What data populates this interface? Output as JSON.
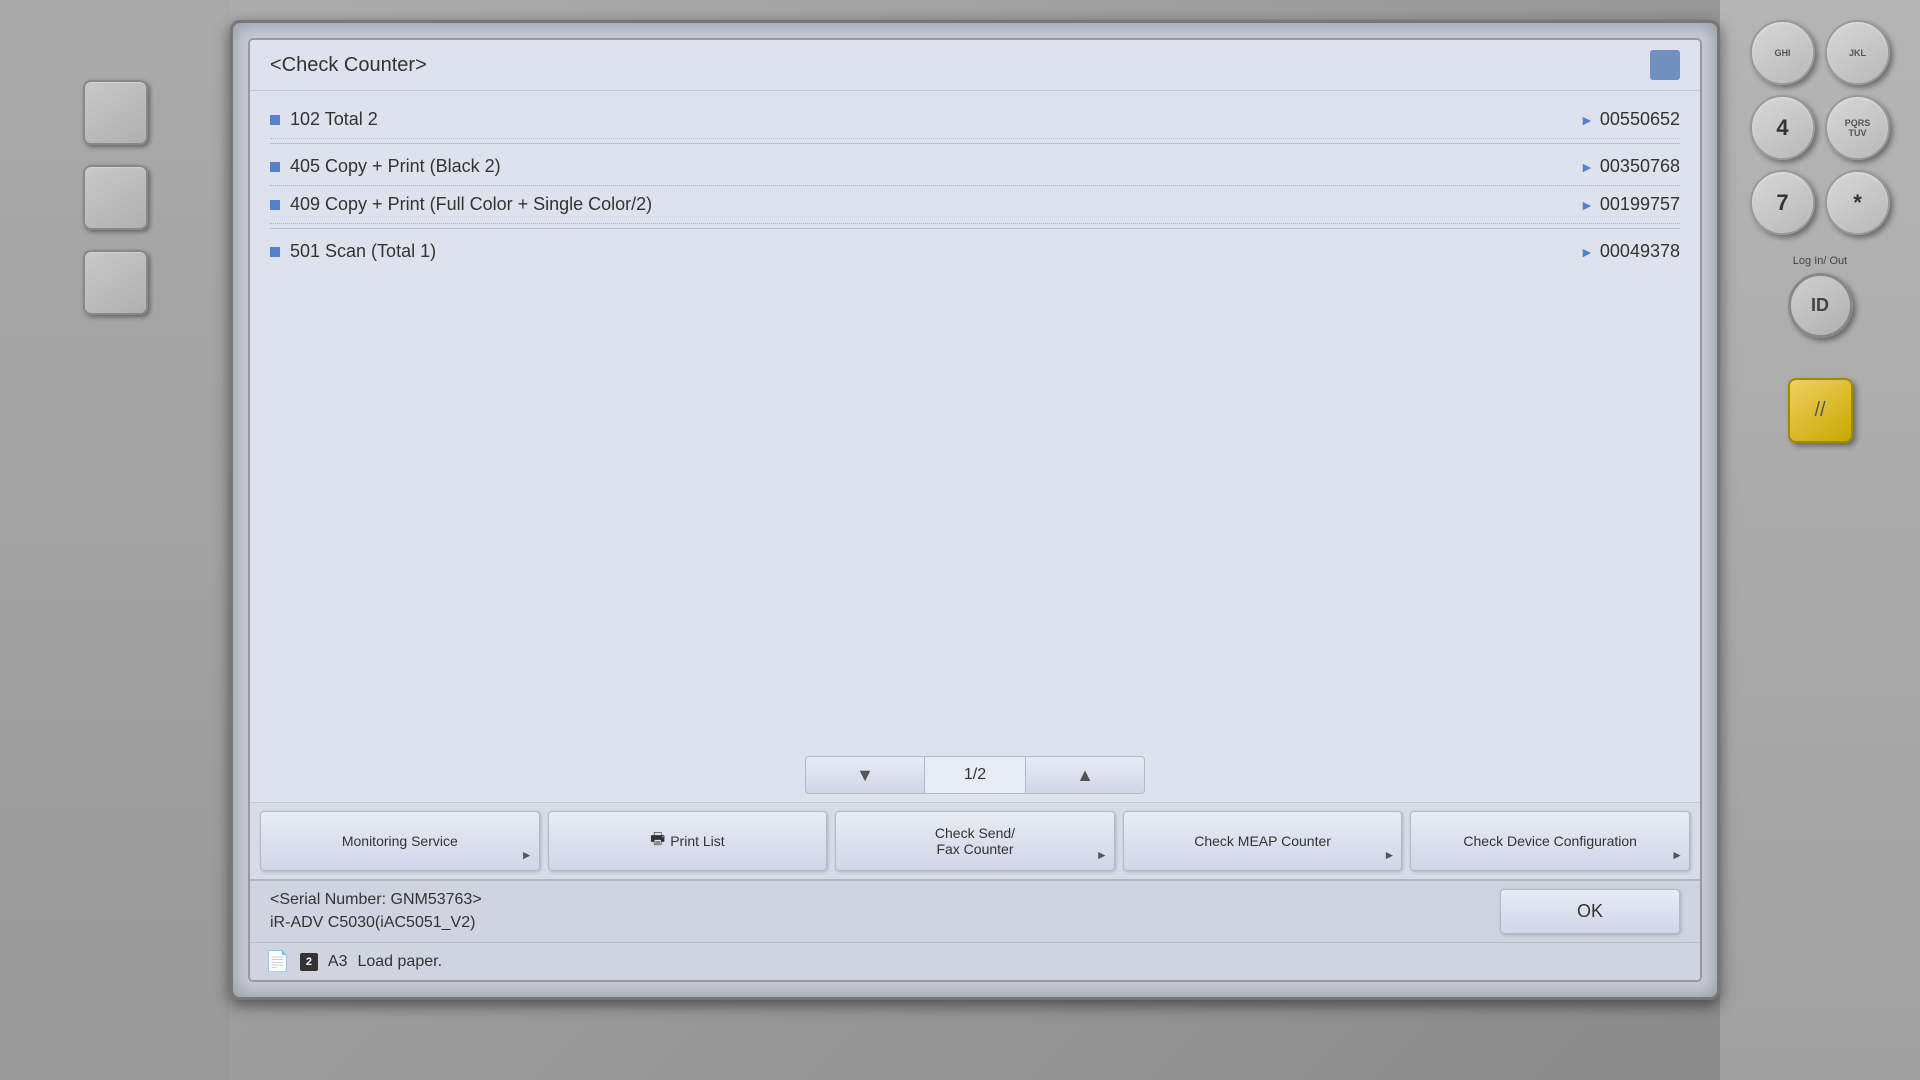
{
  "screen": {
    "title": "<Check Counter>",
    "title_icon_label": "icon"
  },
  "counters": [
    {
      "id": "102",
      "label": "102   Total 2",
      "value": "00550652"
    },
    {
      "id": "405",
      "label": "405   Copy + Print (Black 2)",
      "value": "00350768"
    },
    {
      "id": "409",
      "label": "409   Copy + Print (Full Color + Single Color/2)",
      "value": "00199757"
    },
    {
      "id": "501",
      "label": "501   Scan (Total 1)",
      "value": "00049378"
    }
  ],
  "pagination": {
    "current": "1/2",
    "prev_arrow": "▼",
    "next_arrow": "▲"
  },
  "buttons": {
    "monitoring_service": "Monitoring Service",
    "print_list": "Print List",
    "check_send_fax": "Check Send/\nFax Counter",
    "check_meap": "Check MEAP Counter",
    "check_device": "Check Device Configuration"
  },
  "footer": {
    "serial_line1": "<Serial Number: GNM53763>",
    "serial_line2": "iR-ADV C5030(iAC5051_V2)",
    "ok_label": "OK"
  },
  "status_bar": {
    "badge": "2",
    "paper_size": "A3",
    "message": "Load paper."
  },
  "numpad": {
    "keys": [
      {
        "label": "GHI",
        "digit": ""
      },
      {
        "label": "JKL",
        "digit": ""
      },
      {
        "label": "PQRS",
        "digit": ""
      },
      {
        "label": "TUV",
        "digit": ""
      },
      {
        "label": "",
        "digit": "4"
      },
      {
        "label": "",
        "digit": ""
      },
      {
        "label": "",
        "digit": "7"
      },
      {
        "label": "",
        "digit": ""
      },
      {
        "label": "",
        "digit": "*"
      }
    ],
    "login_label": "Log In/\nOut",
    "id_label": "ID",
    "slash_label": "//"
  }
}
